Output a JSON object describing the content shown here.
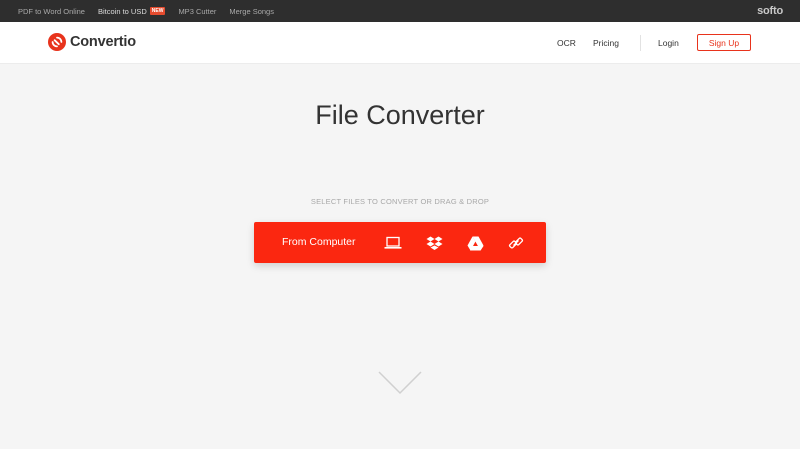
{
  "topbar": {
    "links": [
      {
        "label": "PDF to Word Online"
      },
      {
        "label": "Bitcoin to USD",
        "badge": "NEW"
      },
      {
        "label": "MP3 Cutter"
      },
      {
        "label": "Merge Songs"
      }
    ],
    "brand": "softo"
  },
  "header": {
    "logo_text": "Convertio",
    "nav": {
      "ocr": "OCR",
      "pricing": "Pricing",
      "login": "Login",
      "signup": "Sign Up"
    }
  },
  "main": {
    "title": "File Converter",
    "subtitle": "SELECT FILES TO CONVERT OR DRAG & DROP",
    "upload": {
      "label": "From Computer",
      "sources": [
        "laptop-icon",
        "dropbox-icon",
        "google-drive-icon",
        "link-icon"
      ]
    }
  },
  "colors": {
    "accent": "#fb2710",
    "logo": "#e8331c",
    "topbar": "#2e2e2e",
    "background": "#f5f5f5"
  }
}
